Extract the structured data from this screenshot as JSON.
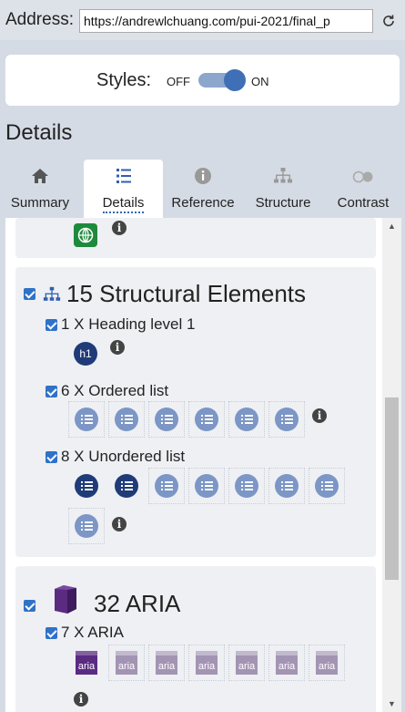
{
  "address": {
    "label": "Address:",
    "url": "https://andrewlchuang.com/pui-2021/final_p",
    "reload_icon": "reload-icon"
  },
  "styles": {
    "label": "Styles:",
    "off": "OFF",
    "on": "ON",
    "state": "on"
  },
  "heading": "Details",
  "tabs": [
    {
      "label": "Summary",
      "icon": "home-icon",
      "active": false
    },
    {
      "label": "Details",
      "icon": "list-icon",
      "active": true
    },
    {
      "label": "Reference",
      "icon": "info-icon",
      "active": false
    },
    {
      "label": "Structure",
      "icon": "sitemap-icon",
      "active": false
    },
    {
      "label": "Contrast",
      "icon": "contrast-icon",
      "active": false
    }
  ],
  "structural": {
    "title": "15 Structural Elements",
    "groups": [
      {
        "label": "1 X Heading level 1",
        "icon_text": "h1"
      },
      {
        "label": "6 X Ordered list"
      },
      {
        "label": "8 X Unordered list"
      }
    ]
  },
  "aria": {
    "title": "32 ARIA",
    "groups": [
      {
        "label": "7 X ARIA",
        "icon_text": "aria"
      }
    ]
  },
  "colors": {
    "accent": "#2f72c8",
    "dark_list": "#1f3b78",
    "light_list": "#7c96c6",
    "aria_purple": "#5b2b82",
    "aria_light": "#a394b4",
    "globe_green": "#1e8a3c"
  }
}
